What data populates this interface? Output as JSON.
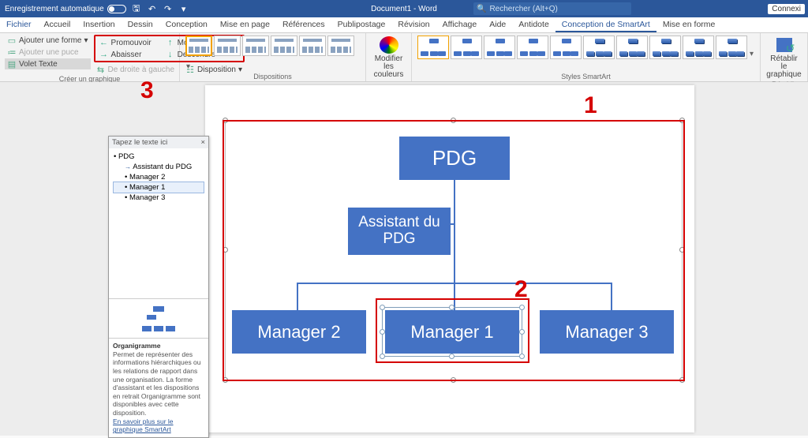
{
  "titlebar": {
    "autosave": "Enregistrement automatique",
    "doc_title": "Document1 - Word",
    "search_placeholder": "Rechercher (Alt+Q)",
    "connect": "Connexi"
  },
  "tabs": [
    "Fichier",
    "Accueil",
    "Insertion",
    "Dessin",
    "Conception",
    "Mise en page",
    "Références",
    "Publipostage",
    "Révision",
    "Affichage",
    "Aide",
    "Antidote",
    "Conception de SmartArt",
    "Mise en forme"
  ],
  "ribbon": {
    "create": {
      "add_shape": "Ajouter une forme",
      "add_bullet": "Ajouter une puce",
      "text_pane": "Volet Texte",
      "promote": "Promouvoir",
      "demote": "Abaisser",
      "up": "Monter",
      "down": "Descendre",
      "rtl": "De droite à gauche",
      "layout": "Disposition",
      "label": "Créer un graphique"
    },
    "layouts_label": "Dispositions",
    "colors_btn": "Modifier les couleurs",
    "styles_label": "Styles SmartArt",
    "reset_btn": "Rétablir le graphique",
    "reset_label": "Rétablir"
  },
  "textpane": {
    "title": "Tapez le texte ici",
    "items": [
      {
        "level": 1,
        "text": "PDG"
      },
      {
        "level": 2,
        "text": "Assistant du PDG",
        "arrow": true
      },
      {
        "level": 2,
        "text": "Manager 2"
      },
      {
        "level": 2,
        "text": "Manager 1",
        "selected": true
      },
      {
        "level": 2,
        "text": "Manager 3"
      }
    ],
    "desc_title": "Organigramme",
    "desc_body": "Permet de représenter des informations hiérarchiques ou les relations de rapport dans une organisation. La forme d'assistant et les dispositions en retrait Organigramme sont disponibles avec cette disposition.",
    "desc_link": "En savoir plus sur le graphique SmartArt"
  },
  "smartart": {
    "pdg": "PDG",
    "assistant": "Assistant du PDG",
    "m1": "Manager 1",
    "m2": "Manager 2",
    "m3": "Manager 3"
  },
  "annotations": {
    "n1": "1",
    "n2": "2",
    "n3": "3"
  }
}
